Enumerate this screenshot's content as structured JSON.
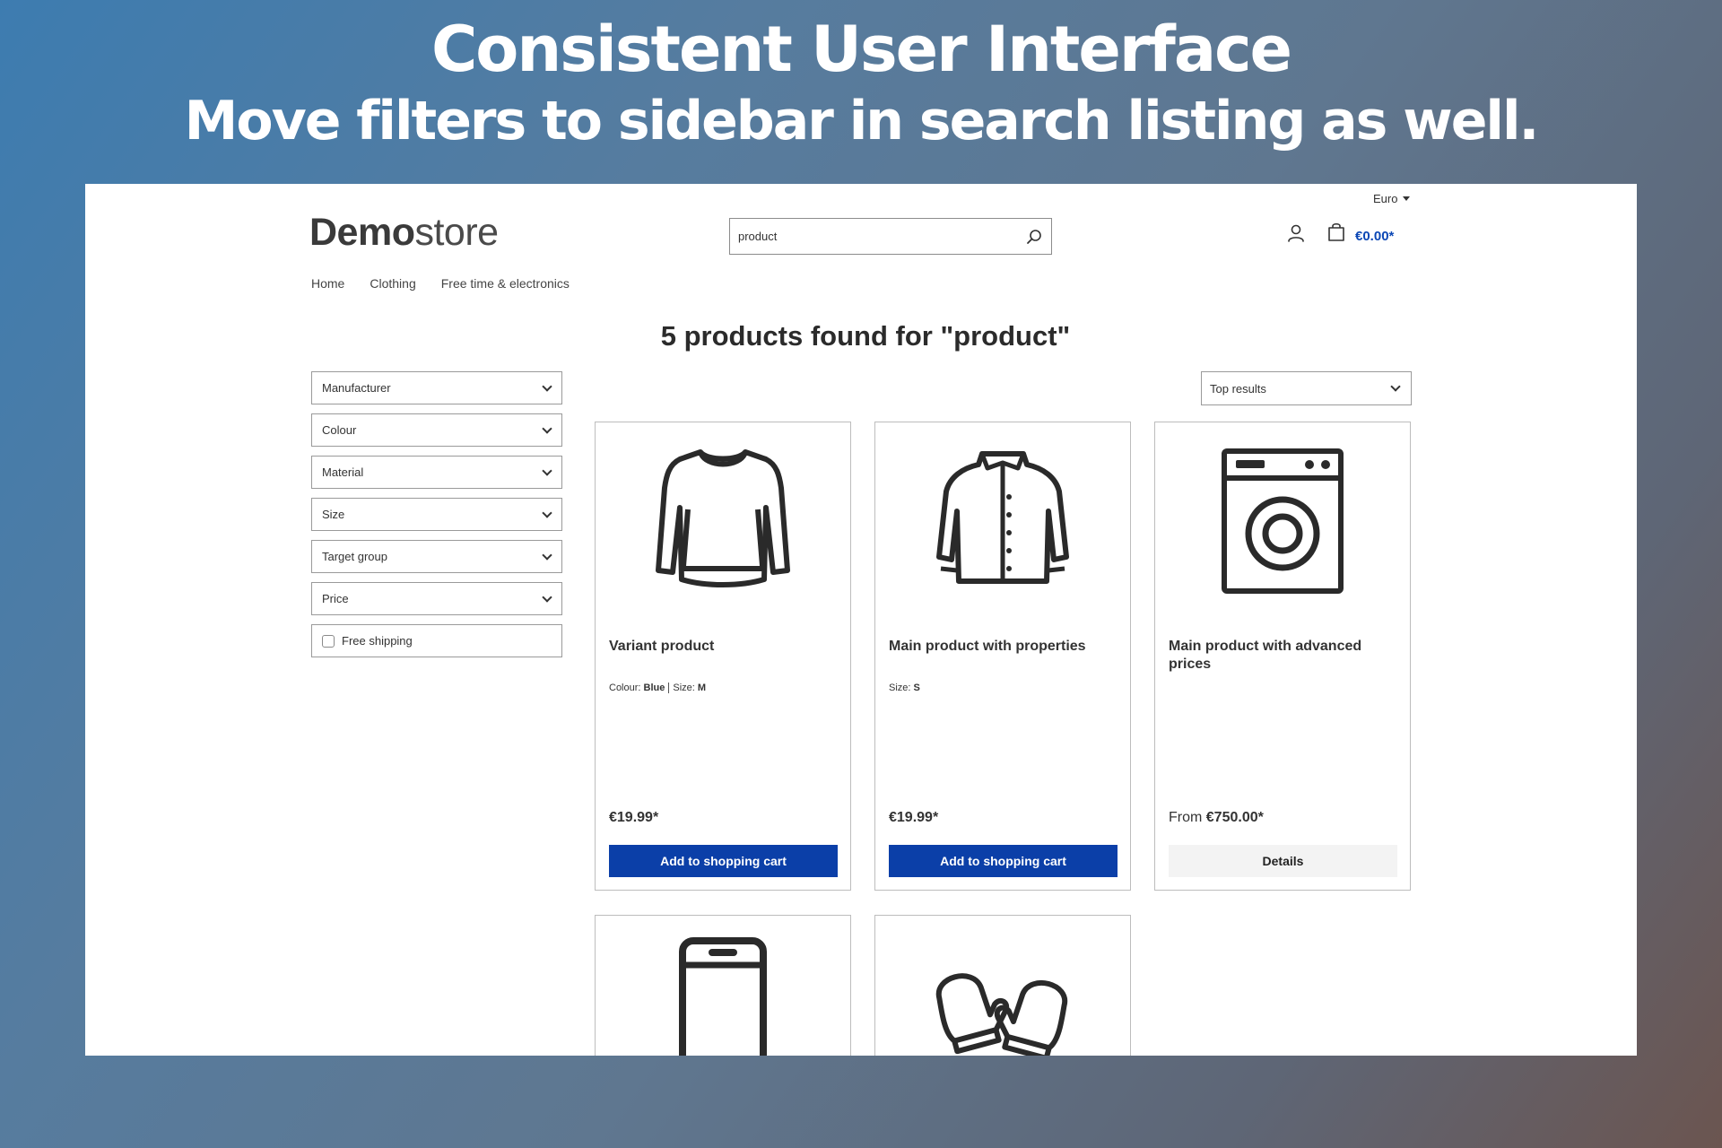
{
  "banner": {
    "title": "Consistent User Interface",
    "subtitle": "Move filters to sidebar in search listing as well."
  },
  "header": {
    "currency": "Euro",
    "logo_bold": "Demo",
    "logo_light": "store",
    "search_value": "product",
    "cart_total": "€0.00*"
  },
  "nav": [
    "Home",
    "Clothing",
    "Free time & electronics"
  ],
  "results": {
    "title": "5 products found for \"product\"",
    "sort_label": "Top results"
  },
  "filters": {
    "dropdowns": [
      "Manufacturer",
      "Colour",
      "Material",
      "Size",
      "Target group",
      "Price"
    ],
    "free_shipping": "Free shipping"
  },
  "products": [
    {
      "name": "Variant product",
      "icon": "sweater-icon",
      "prop1_label": "Colour:",
      "prop1_value": "Blue",
      "prop2_label": "Size:",
      "prop2_value": "M",
      "price": "€19.99*",
      "button": "Add to shopping cart"
    },
    {
      "name": "Main product with properties",
      "icon": "jacket-icon",
      "prop1_label": "Size:",
      "prop1_value": "S",
      "price": "€19.99*",
      "button": "Add to shopping cart"
    },
    {
      "name": "Main product with advanced prices",
      "icon": "washing-machine-icon",
      "price_prefix": "From",
      "price": "€750.00*",
      "button": "Details"
    },
    {
      "icon": "smartphone-icon"
    },
    {
      "icon": "mittens-icon"
    }
  ],
  "colors": {
    "primary": "#0b3fa8",
    "cart_amount": "#0b47b5"
  }
}
